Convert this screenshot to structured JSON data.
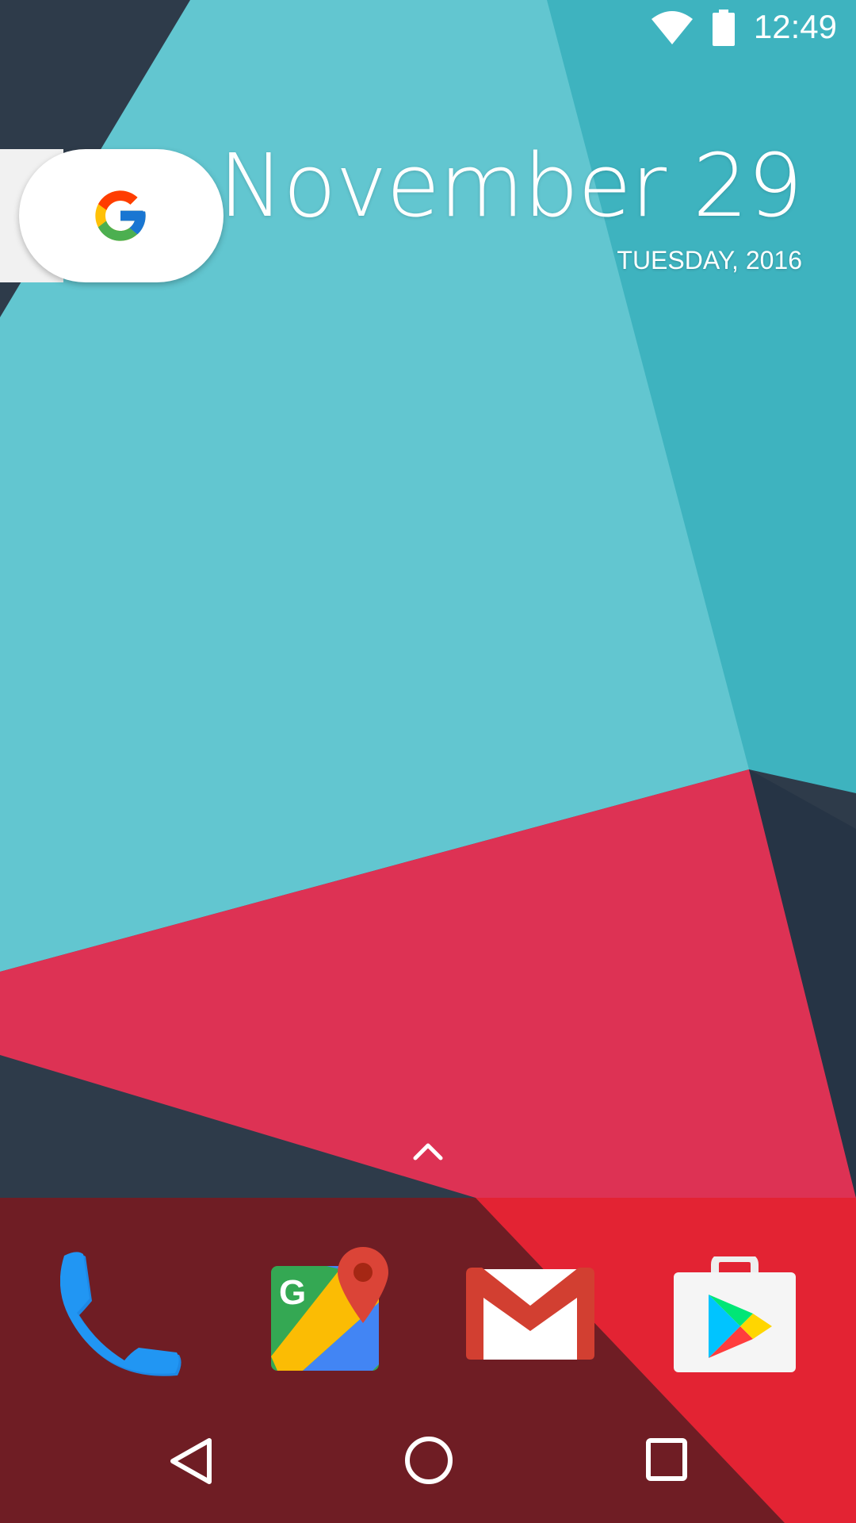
{
  "status_bar": {
    "time": "12:49",
    "icons": [
      "wifi-icon",
      "battery-icon"
    ]
  },
  "widget": {
    "search_icon": "google-g-icon",
    "date_main": "November 29",
    "date_sub": "TUESDAY, 2016"
  },
  "dock": {
    "apps": [
      "phone-icon",
      "maps-icon",
      "gmail-icon",
      "play-store-icon"
    ]
  },
  "nav": {
    "buttons": [
      "back-icon",
      "home-icon",
      "recents-icon"
    ]
  },
  "colors": {
    "wallpaper_cyan": "#62c6d0",
    "wallpaper_teal": "#3eb3bf",
    "wallpaper_navy": "#2d3a48",
    "wallpaper_red": "#dd3254",
    "dock_dark": "#6f1d24",
    "dock_red": "#e32333"
  }
}
